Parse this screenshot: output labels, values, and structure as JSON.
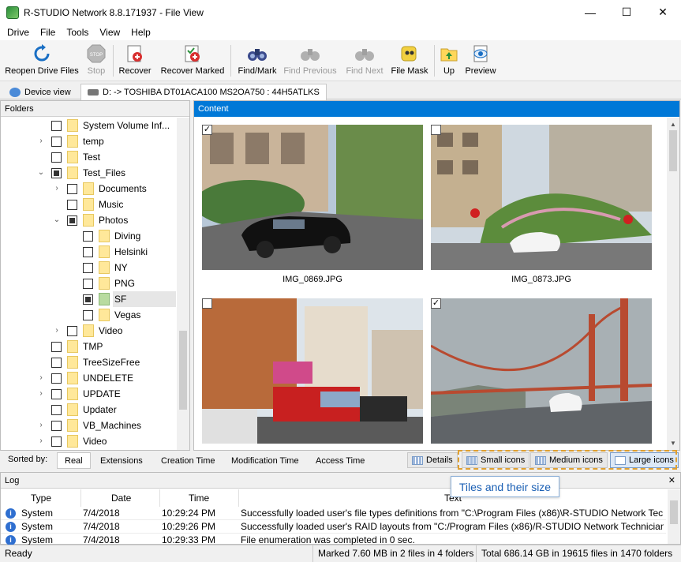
{
  "window": {
    "title": "R-STUDIO Network 8.8.171937 - File View",
    "minimize": "—",
    "maximize": "☐",
    "close": "✕"
  },
  "menu": [
    "Drive",
    "File",
    "Tools",
    "View",
    "Help"
  ],
  "toolbar": {
    "reopen": "Reopen Drive Files",
    "stop": "Stop",
    "recover": "Recover",
    "recover_marked": "Recover Marked",
    "find_mark": "Find/Mark",
    "find_previous": "Find Previous",
    "find_next": "Find Next",
    "file_mask": "File Mask",
    "up": "Up",
    "preview": "Preview",
    "stop_badge": "STOP"
  },
  "tabs": {
    "device_view": "Device view",
    "drive": "D: -> TOSHIBA DT01ACA100 MS2OA750 : 44H5ATLKS"
  },
  "folders": {
    "header": "Folders",
    "items": [
      {
        "label": "System Volume Inf..."
      },
      {
        "label": "temp"
      },
      {
        "label": "Test"
      },
      {
        "label": "Test_Files"
      },
      {
        "label": "Documents"
      },
      {
        "label": "Music"
      },
      {
        "label": "Photos"
      },
      {
        "label": "Diving"
      },
      {
        "label": "Helsinki"
      },
      {
        "label": "NY"
      },
      {
        "label": "PNG"
      },
      {
        "label": "SF"
      },
      {
        "label": "Vegas"
      },
      {
        "label": "Video"
      },
      {
        "label": "TMP"
      },
      {
        "label": "TreeSizeFree"
      },
      {
        "label": "UNDELETE"
      },
      {
        "label": "UPDATE"
      },
      {
        "label": "Updater"
      },
      {
        "label": "VB_Machines"
      },
      {
        "label": "Video"
      }
    ]
  },
  "content": {
    "header": "Content",
    "tiles": [
      {
        "name": "IMG_0869.JPG",
        "checked": "✓"
      },
      {
        "name": "IMG_0873.JPG",
        "checked": ""
      },
      {
        "name": "",
        "checked": ""
      },
      {
        "name": "",
        "checked": "✓"
      }
    ]
  },
  "sortbar": {
    "label": "Sorted by:",
    "tabs": [
      "Real",
      "Extensions",
      "Creation Time",
      "Modification Time",
      "Access Time"
    ],
    "views": [
      "Details",
      "Small icons",
      "Medium icons",
      "Large icons"
    ]
  },
  "callout": "Tiles and their size",
  "log": {
    "header": "Log",
    "columns": [
      "Type",
      "Date",
      "Time",
      "Text"
    ],
    "rows": [
      {
        "type": "System",
        "date": "7/4/2018",
        "time": "10:29:24 PM",
        "text": "Successfully loaded user's file types definitions from \"C:\\Program Files (x86)\\R-STUDIO Network Tec..."
      },
      {
        "type": "System",
        "date": "7/4/2018",
        "time": "10:29:26 PM",
        "text": "Successfully loaded user's RAID layouts from \"C:/Program Files (x86)/R-STUDIO Network Technician..."
      },
      {
        "type": "System",
        "date": "7/4/2018",
        "time": "10:29:33 PM",
        "text": "File enumeration was completed in 0 sec."
      }
    ]
  },
  "status": {
    "ready": "Ready",
    "marked": "Marked 7.60 MB in 2 files in 4 folders",
    "total": "Total 686.14 GB in 19615 files in 1470 folders"
  },
  "colors": {
    "accent": "#0078d7",
    "folder": "#ffe89a"
  }
}
